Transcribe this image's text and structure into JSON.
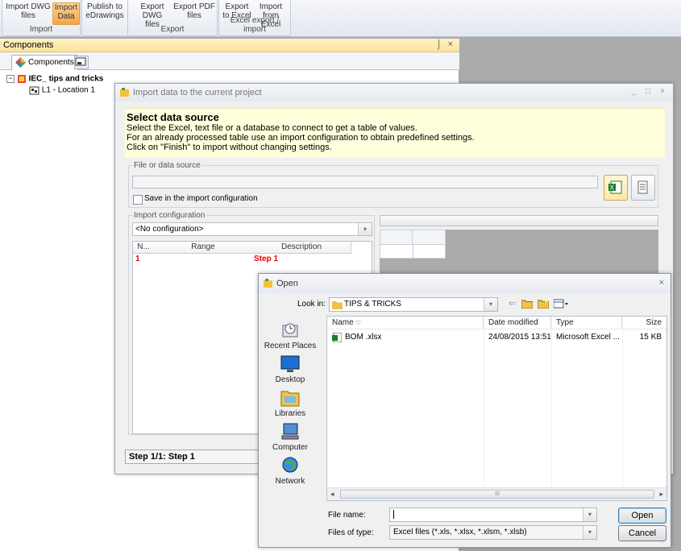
{
  "ribbon": {
    "groups": [
      {
        "label": "Import",
        "buttons": [
          "Import DWG\nfiles",
          "Import\nData"
        ]
      },
      {
        "label": "",
        "buttons": [
          "Publish to\neDrawings"
        ]
      },
      {
        "label": "Export",
        "buttons": [
          "Export DWG\nfiles",
          "Export PDF\nfiles"
        ]
      },
      {
        "label": "Excel export / import",
        "buttons": [
          "Export\nto Excel",
          "Import\nfrom Excel"
        ]
      }
    ]
  },
  "components_panel": {
    "title": "Components",
    "pin": "⌡",
    "close": "×",
    "tab_label": "Components",
    "tree": {
      "root": "IEC_ tips and tricks",
      "child": "L1 - Location 1",
      "expander": "−"
    }
  },
  "import_dialog": {
    "title": "Import data to the current project",
    "heading": "Select data source",
    "desc_lines": [
      "Select the Excel, text file or a database to connect to get a table of values.",
      "For an already processed table use an import configuration to obtain predefined settings.",
      "Click on \"Finish\" to import without changing settings."
    ],
    "file_source_legend": "File or data source",
    "save_in_config": "Save in the import configuration",
    "import_config_legend": "Import configuration",
    "config_value": "<No configuration>",
    "grid_headers": [
      "N...",
      "Range",
      "Description"
    ],
    "grid_row": {
      "n": "1",
      "range": "",
      "desc": "Step 1"
    },
    "step_status": "Step 1/1: Step 1",
    "window_buttons": [
      "_",
      "□",
      "×"
    ]
  },
  "open_dialog": {
    "title": "Open",
    "close": "×",
    "look_in_label": "Look in:",
    "look_in_value": "TIPS & TRICKS",
    "places": [
      "Recent Places",
      "Desktop",
      "Libraries",
      "Computer",
      "Network"
    ],
    "columns": [
      "Name",
      "Date modified",
      "Type",
      "Size"
    ],
    "files": [
      {
        "name": "BOM .xlsx",
        "date": "24/08/2015 13:51",
        "type": "Microsoft Excel ...",
        "size": "15 KB"
      }
    ],
    "file_name_label": "File name:",
    "file_name_value": "",
    "file_type_label": "Files of type:",
    "file_type_value": "Excel files (*.xls, *.xlsx, *.xlsm, *.xlsb)",
    "open_button": "Open",
    "cancel_button": "Cancel",
    "scroll_thumb": "III"
  },
  "colors": {
    "accent": "#f2a54a",
    "header_bg": "#ffffdc",
    "step_red": "#e00000"
  }
}
